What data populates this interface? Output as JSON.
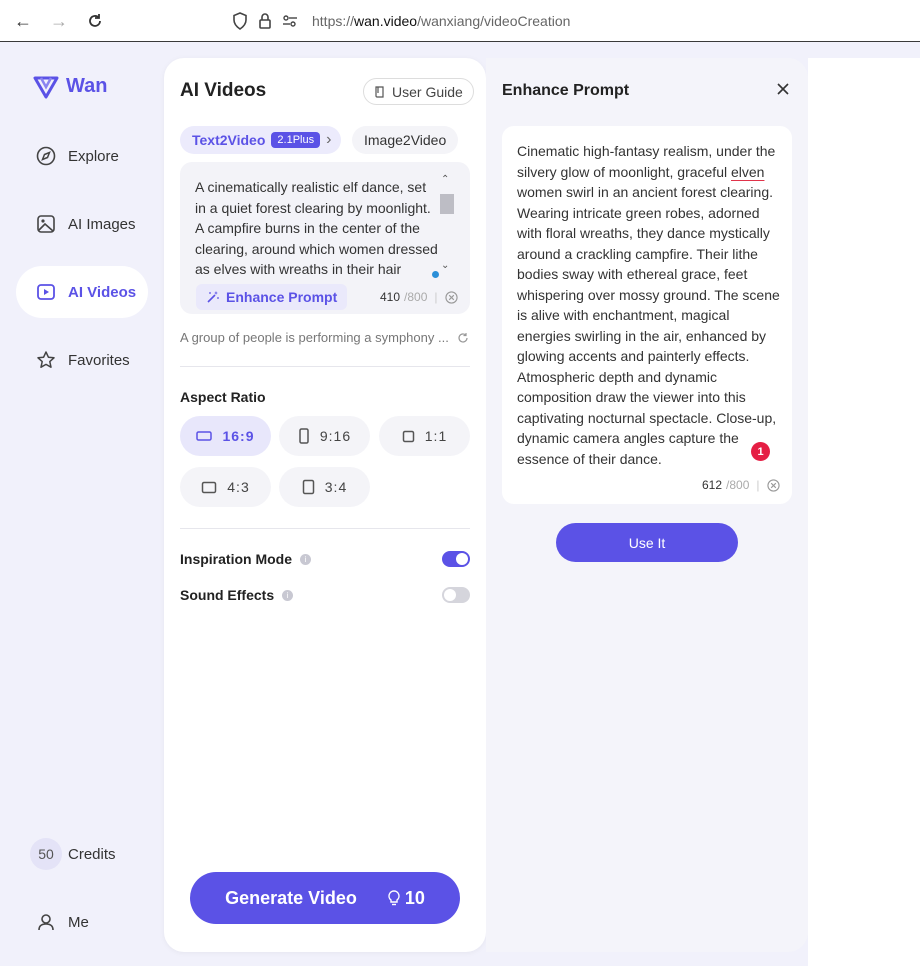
{
  "browser": {
    "url_prefix": "https://",
    "url_host": "wan.video",
    "url_path": "/wanxiang/videoCreation"
  },
  "sidebar": {
    "logo": "Wan",
    "items": [
      {
        "label": "Explore",
        "icon": "compass-icon"
      },
      {
        "label": "AI Images",
        "icon": "image-icon"
      },
      {
        "label": "AI Videos",
        "icon": "video-icon"
      },
      {
        "label": "Favorites",
        "icon": "star-icon"
      }
    ],
    "credits_value": "50",
    "credits_label": "Credits",
    "me_label": "Me"
  },
  "main": {
    "title": "AI Videos",
    "user_guide": "User Guide",
    "tabs": {
      "t2v_label": "Text2Video",
      "t2v_badge": "2.1Plus",
      "i2v_label": "Image2Video"
    },
    "prompt_text": "A cinematically realistic elf dance, set in a quiet forest clearing by moonlight. A campfire burns in the center of the clearing, around which women dressed as elves with wreaths in their hair",
    "enhance_label": "Enhance Prompt",
    "char_count": "410",
    "char_max": "/800",
    "suggestion": "A group of people is performing a symphony ...",
    "aspect_ratio_label": "Aspect Ratio",
    "ratios": [
      "16:9",
      "9:16",
      "1:1",
      "4:3",
      "3:4"
    ],
    "selected_ratio": "16:9",
    "inspiration_label": "Inspiration Mode",
    "inspiration_on": true,
    "sound_label": "Sound Effects",
    "sound_on": false,
    "generate_label": "Generate Video",
    "generate_cost": "10"
  },
  "enhance_panel": {
    "title": "Enhance Prompt",
    "text_before": "Cinematic high-fantasy realism, under the silvery glow of moonlight, graceful ",
    "text_flagged": "elven",
    "text_after": " women swirl in an ancient forest clearing. Wearing intricate green robes, adorned with floral wreaths, they dance mystically around a crackling campfire. Their lithe bodies sway with ethereal grace, feet whispering over mossy ground. The scene is alive with enchantment, magical energies swirling in the air, enhanced by glowing accents and painterly effects. Atmospheric depth and dynamic composition draw the viewer into this captivating nocturnal spectacle. Close-up, dynamic camera angles capture the essence of their dance.",
    "issue_count": "1",
    "char_count": "612",
    "char_max": "/800",
    "use_label": "Use It"
  },
  "colors": {
    "accent": "#5b52e6",
    "error": "#e51e44"
  }
}
